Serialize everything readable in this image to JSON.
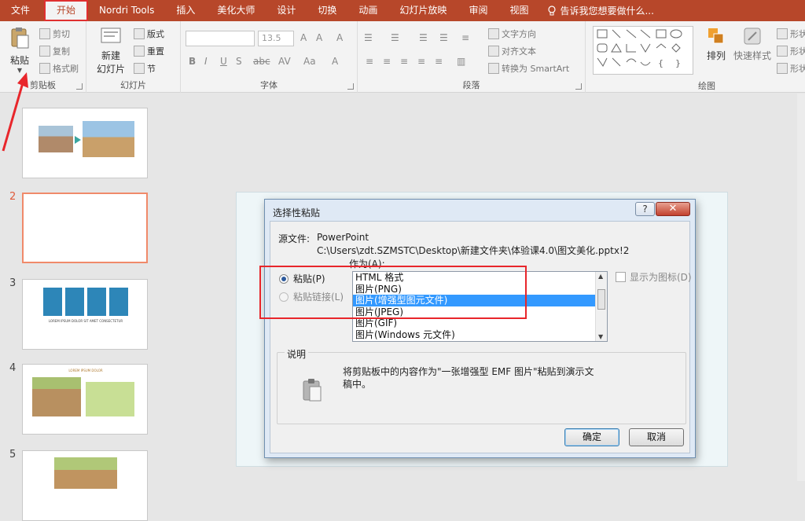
{
  "menubar": {
    "tabs": [
      "文件",
      "开始",
      "Nordri Tools",
      "插入",
      "美化大师",
      "设计",
      "切换",
      "动画",
      "幻灯片放映",
      "审阅",
      "视图"
    ],
    "tell_me": "告诉我您想要做什么..."
  },
  "ribbon": {
    "clipboard": {
      "paste": "粘贴",
      "cut": "剪切",
      "copy": "复制",
      "format_painter": "格式刷",
      "label": "剪贴板"
    },
    "slides": {
      "new_slide_line1": "新建",
      "new_slide_line2": "幻灯片",
      "layout": "版式",
      "reset": "重置",
      "section": "节",
      "label": "幻灯片"
    },
    "font": {
      "size": "13.5",
      "label": "字体"
    },
    "paragraph": {
      "text_direction": "文字方向",
      "align_text": "对齐文本",
      "smartart": "转换为 SmartArt",
      "label": "段落"
    },
    "drawing": {
      "arrange": "排列",
      "quick_styles": "快速样式",
      "shape_fill": "形状",
      "shape_outline": "形状",
      "shape_effects": "形状",
      "label": "绘图"
    }
  },
  "slides_panel": {
    "numbers": [
      "2",
      "3",
      "4",
      "5"
    ]
  },
  "thumb_text": {
    "t3_title": "LOREM IPSUM DOLOR SIT AMET CONSECTETUR",
    "t4_title": "LOREM IPSUM DOLOR"
  },
  "dialog": {
    "title": "选择性粘贴",
    "help": "?",
    "close": "✕",
    "source_label": "源文件:",
    "source_app": "PowerPoint",
    "source_path": "C:\\Users\\zdt.SZMSTC\\Desktop\\新建文件夹\\体验课4.0\\图文美化.pptx!2",
    "as_label": "作为(A):",
    "paste_option": "粘贴(P)",
    "paste_link_option": "粘贴链接(L)",
    "list_items": [
      "HTML 格式",
      "图片(PNG)",
      "图片(增强型图元文件)",
      "图片(JPEG)",
      "图片(GIF)",
      "图片(Windows 元文件)"
    ],
    "display_as_icon": "显示为图标(D)",
    "description_label": "说明",
    "description_text_1": "将剪贴板中的内容作为\"一张增强型 EMF 图片\"粘贴到演示文",
    "description_text_2": "稿中。",
    "ok": "确定",
    "cancel": "取消"
  },
  "colors": {
    "accent": "#b7472a",
    "highlight": "#e8262b",
    "selection": "#3399ff"
  }
}
